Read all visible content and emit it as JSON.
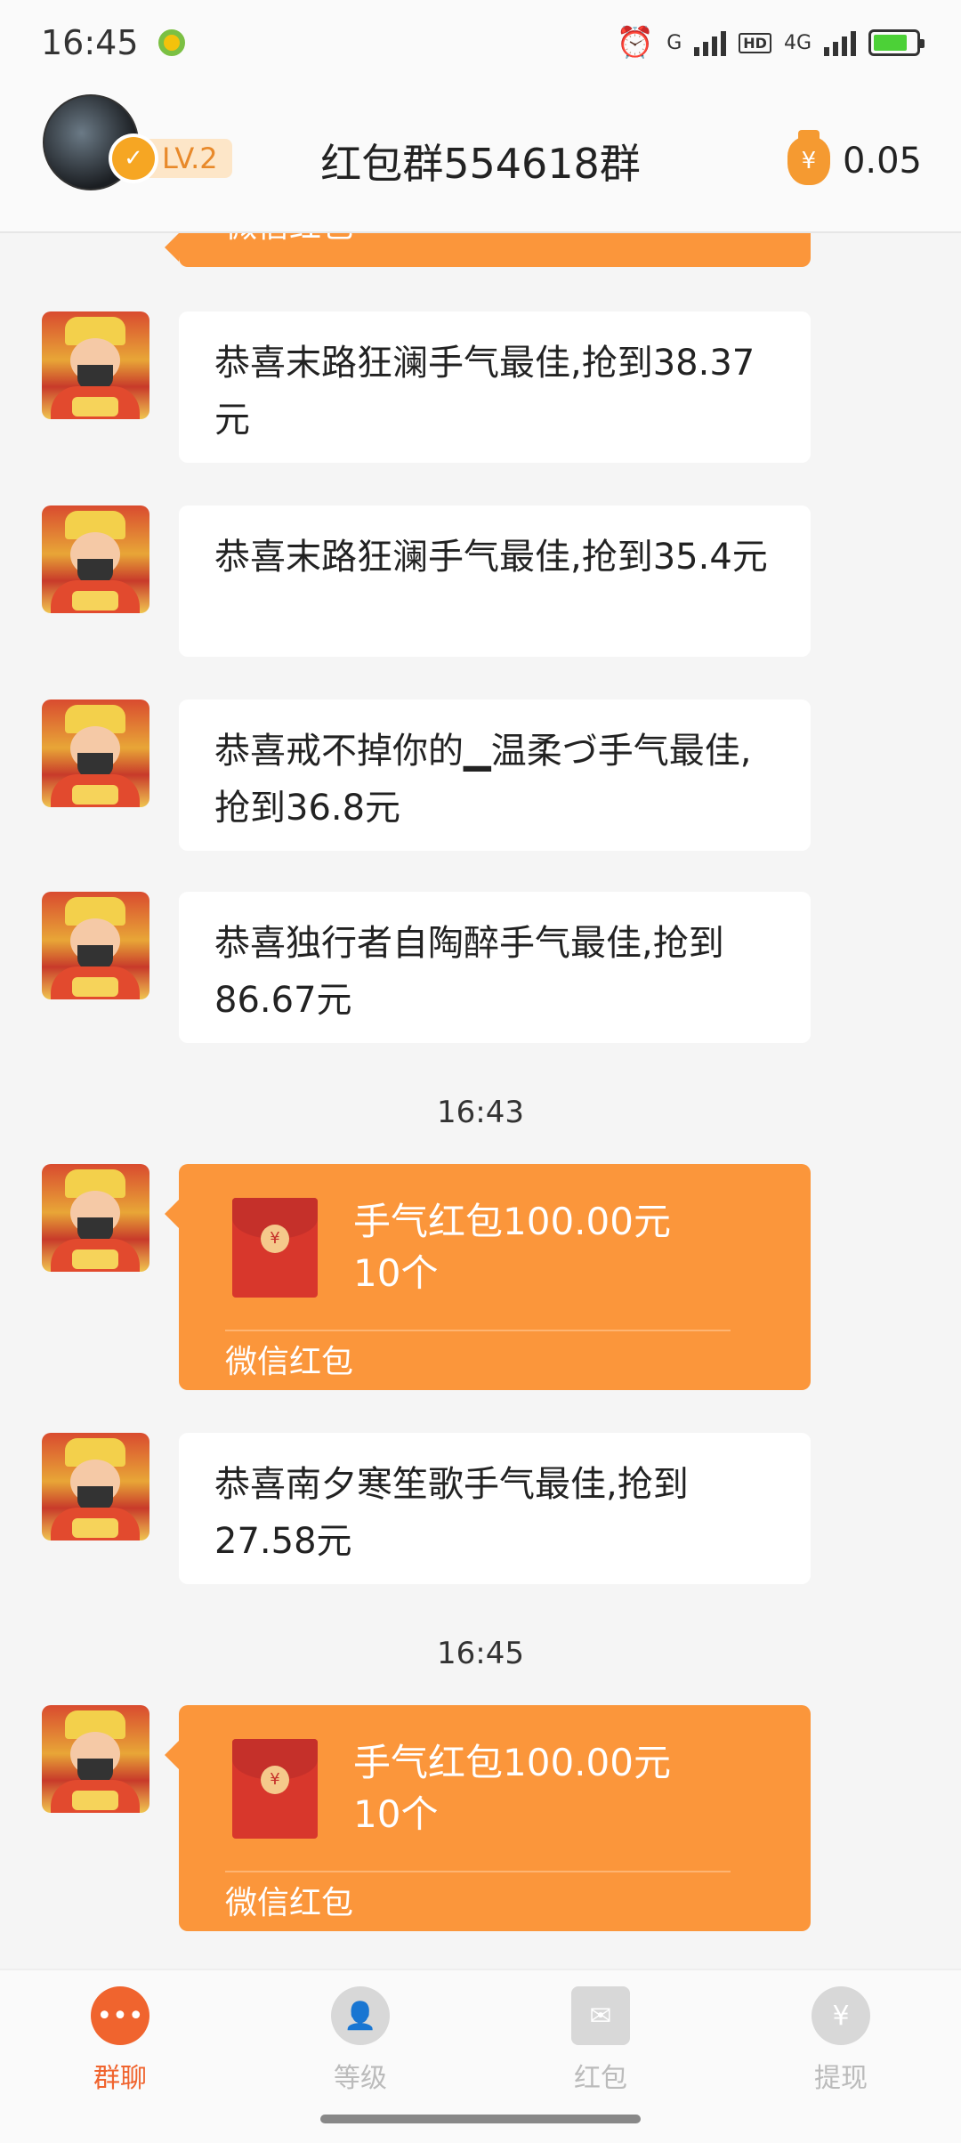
{
  "status": {
    "time": "16:45",
    "net_label": "4G",
    "hd": "HD",
    "g": "G"
  },
  "header": {
    "title": "红包群554618群",
    "level": "LV.2",
    "balance": "0.05"
  },
  "top_partial_footer": "微信红包",
  "messages": [
    {
      "type": "text",
      "text": "恭喜末路狂澜手气最佳,抢到38.37元"
    },
    {
      "type": "text",
      "text": "恭喜末路狂澜手气最佳,抢到35.4元"
    },
    {
      "type": "text",
      "text": "恭喜戒不掉你的▁温柔づ手气最佳,抢到36.8元"
    },
    {
      "type": "text",
      "text": "恭喜独行者自陶醉手气最佳,抢到86.67元"
    },
    {
      "type": "time",
      "text": "16:43"
    },
    {
      "type": "redpacket",
      "title": "手气红包100.00元",
      "count": "10个",
      "footer": "微信红包"
    },
    {
      "type": "text",
      "text": "恭喜南夕寒笙歌手气最佳,抢到27.58元"
    },
    {
      "type": "time",
      "text": "16:45"
    },
    {
      "type": "redpacket",
      "title": "手气红包100.00元",
      "count": "10个",
      "footer": "微信红包"
    }
  ],
  "tabs": [
    {
      "label": "群聊",
      "icon": "chat-bubble-icon",
      "active": true
    },
    {
      "label": "等级",
      "icon": "user-level-icon",
      "active": false
    },
    {
      "label": "红包",
      "icon": "red-envelope-icon",
      "active": false
    },
    {
      "label": "提现",
      "icon": "money-bag-icon",
      "active": false
    }
  ],
  "colors": {
    "accent": "#f0642e",
    "redpacket": "#fb963b",
    "envelope": "#d8372c"
  }
}
